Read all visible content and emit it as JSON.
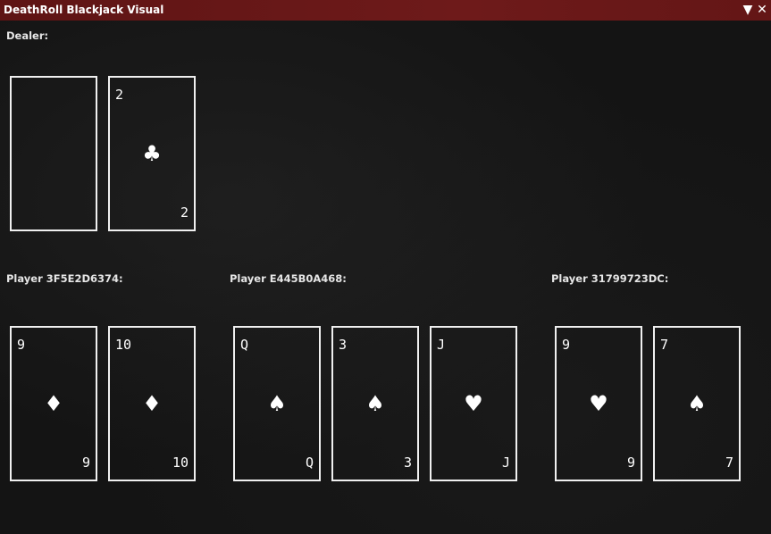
{
  "window": {
    "title": "DeathRoll Blackjack Visual",
    "collapse_icon": "▼",
    "close_icon": "✕"
  },
  "dealer": {
    "label": "Dealer:",
    "cards": [
      {
        "face_down": true,
        "rank": "",
        "suit": ""
      },
      {
        "face_down": false,
        "rank": "2",
        "suit": "♣"
      }
    ]
  },
  "players": [
    {
      "label": "Player 3F5E2D6374:",
      "cards": [
        {
          "rank": "9",
          "suit": "♦"
        },
        {
          "rank": "10",
          "suit": "♦"
        }
      ]
    },
    {
      "label": "Player E445B0A468:",
      "cards": [
        {
          "rank": "Q",
          "suit": "♠"
        },
        {
          "rank": "3",
          "suit": "♠"
        },
        {
          "rank": "J",
          "suit": "♥"
        }
      ]
    },
    {
      "label": "Player 31799723DC:",
      "cards": [
        {
          "rank": "9",
          "suit": "♥"
        },
        {
          "rank": "7",
          "suit": "♠"
        }
      ]
    }
  ]
}
